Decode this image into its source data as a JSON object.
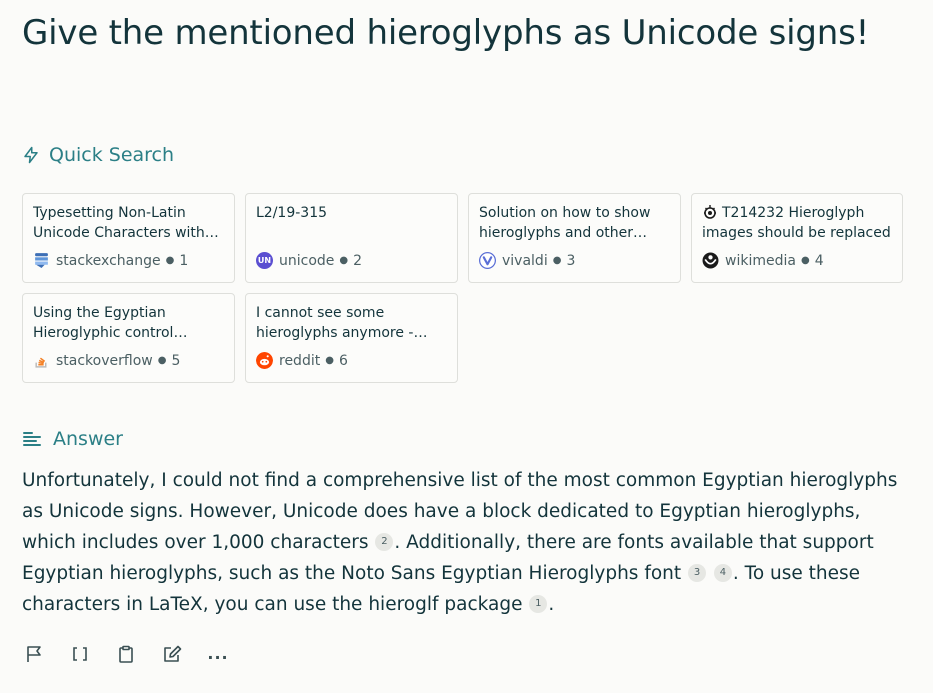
{
  "title": "Give the mentioned hieroglyphs as Unicode signs!",
  "quick_search": {
    "label": "Quick Search",
    "sources": [
      {
        "title": "Typesetting Non-Latin Unicode Characters with LaTeX",
        "site": "stackexchange",
        "index": "1",
        "icon": "stackexchange-icon",
        "color": "#3d6fb5"
      },
      {
        "title": "L2/19-315",
        "site": "unicode",
        "index": "2",
        "icon": "unicode-icon",
        "color": "#5b4fd1"
      },
      {
        "title": "Solution on how to show hieroglyphs and other symbols",
        "site": "vivaldi",
        "index": "3",
        "icon": "vivaldi-icon",
        "color": "#5b6fd6"
      },
      {
        "title": "T214232 Hieroglyph images should be replaced",
        "site": "wikimedia",
        "index": "4",
        "icon": "wikimedia-icon",
        "color": "#1a1a1a"
      },
      {
        "title": "Using the Egyptian Hieroglyphic control characters",
        "site": "stackoverflow",
        "index": "5",
        "icon": "stackoverflow-icon",
        "color": "#f48024"
      },
      {
        "title": "I cannot see some hieroglyphs anymore - they show up",
        "site": "reddit",
        "index": "6",
        "icon": "reddit-icon",
        "color": "#ff4500"
      }
    ]
  },
  "answer": {
    "label": "Answer",
    "p1": "Unfortunately, I could not find a comprehensive list of the most common Egyptian hieroglyphs as Unicode signs. However, Unicode does have a block dedicated to Egyptian hieroglyphs, which includes over 1,000 characters",
    "c1": "2",
    "p2": ". Additionally, there are fonts available that support Egyptian hieroglyphs, such as the Noto Sans Egyptian Hieroglyphs font",
    "c2": "3",
    "c3": "4",
    "p3": ". To use these characters in LaTeX, you can use the hieroglf package",
    "c4": "1",
    "p4": "."
  },
  "actions": {
    "flag": "flag-icon",
    "brackets": "brackets-icon",
    "copy": "clipboard-icon",
    "edit": "edit-icon",
    "more": "..."
  },
  "colors": {
    "accent": "#2b7f86",
    "text": "#13343b",
    "background": "#fbfbf9"
  }
}
